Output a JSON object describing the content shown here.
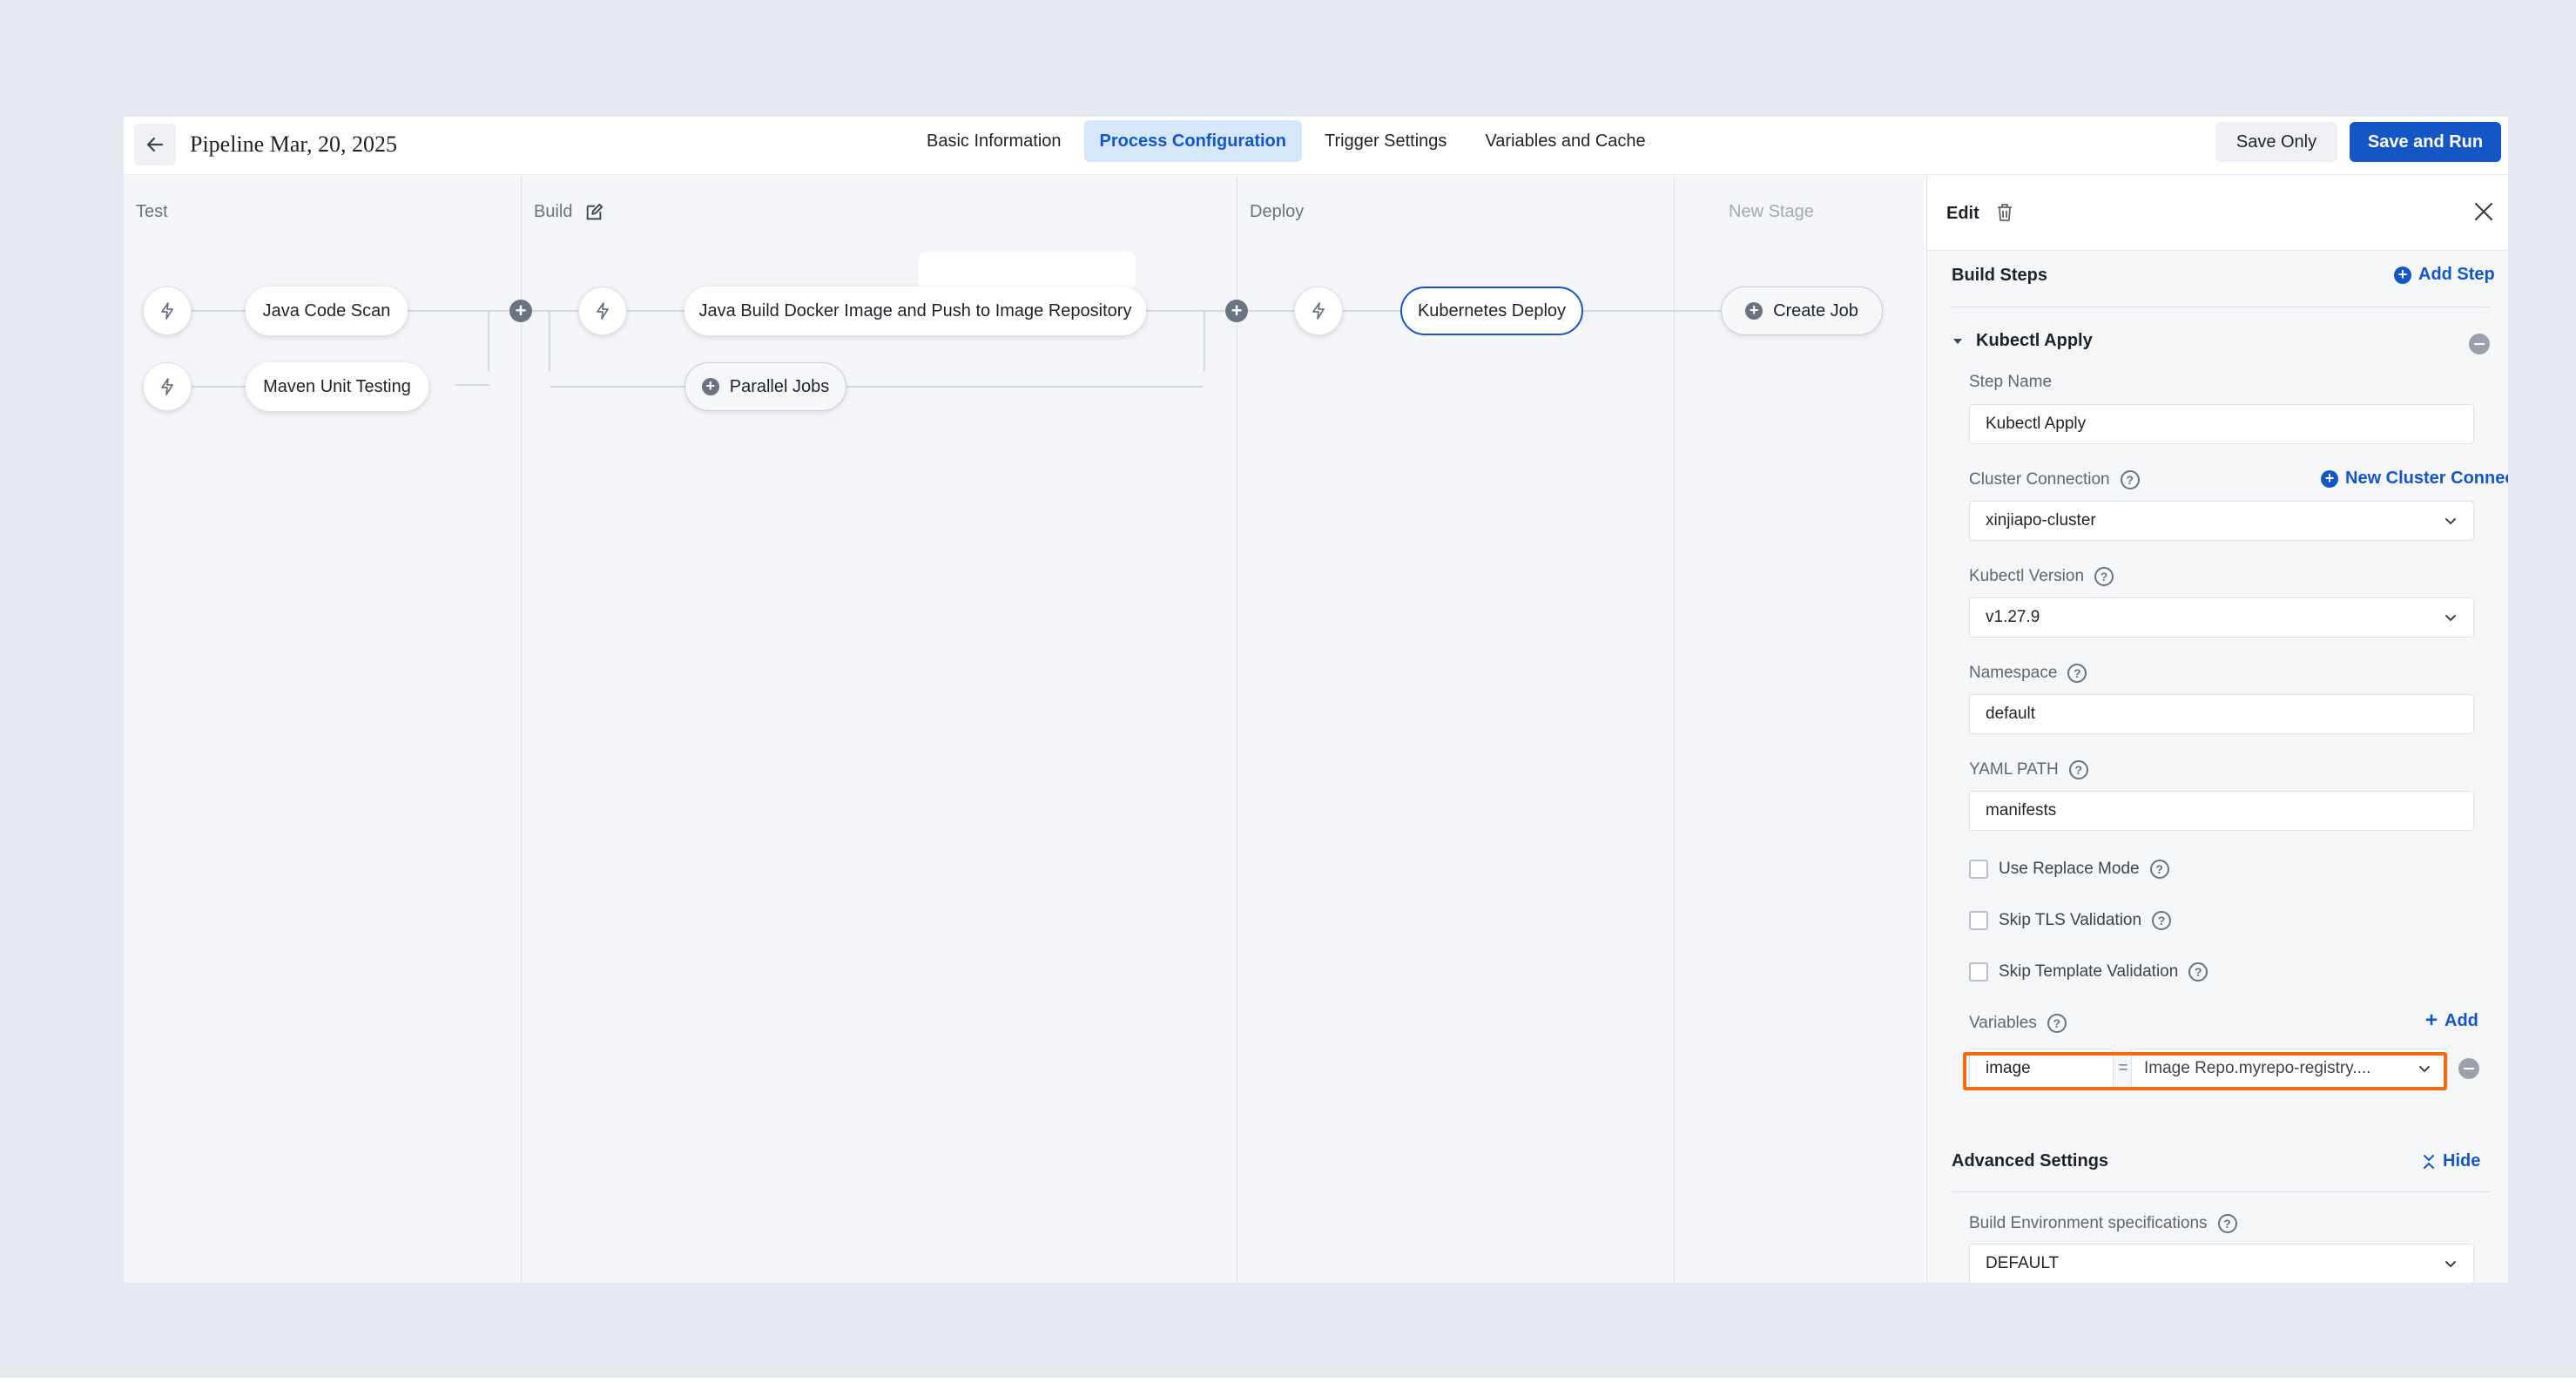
{
  "header": {
    "title": "Pipeline Mar, 20, 2025",
    "tabs": [
      {
        "label": "Basic Information",
        "active": false
      },
      {
        "label": "Process Configuration",
        "active": true
      },
      {
        "label": "Trigger Settings",
        "active": false
      },
      {
        "label": "Variables and Cache",
        "active": false
      }
    ],
    "save_only_label": "Save Only",
    "save_run_label": "Save and Run"
  },
  "stages": [
    {
      "name": "Test",
      "jobs": [
        "Java Code Scan",
        "Maven Unit Testing"
      ]
    },
    {
      "name": "Build",
      "jobs": [
        "Java Build Docker Image and Push to Image Repository"
      ],
      "add_label": "Parallel Jobs"
    },
    {
      "name": "Deploy",
      "jobs": [
        "Kubernetes Deploy"
      ]
    },
    {
      "name": "New Stage",
      "add_label": "Create Job"
    }
  ],
  "panel": {
    "edit_label": "Edit",
    "build_steps_title": "Build Steps",
    "add_step_label": "Add Step",
    "step_title": "Kubectl Apply",
    "step_name_label": "Step Name",
    "step_name_value": "Kubectl Apply",
    "cluster_label": "Cluster Connection",
    "new_cluster_label": "New Cluster Connection",
    "cluster_value": "xinjiapo-cluster",
    "kubectl_version_label": "Kubectl Version",
    "kubectl_version_value": "v1.27.9",
    "namespace_label": "Namespace",
    "namespace_value": "default",
    "yaml_path_label": "YAML PATH",
    "yaml_path_value": "manifests",
    "checkboxes": [
      {
        "label": "Use Replace Mode",
        "checked": false
      },
      {
        "label": "Skip TLS Validation",
        "checked": false
      },
      {
        "label": "Skip Template Validation",
        "checked": false
      }
    ],
    "variables_label": "Variables",
    "add_variable_label": "Add",
    "variable": {
      "key": "image",
      "eq": "=",
      "value": "Image Repo.myrepo-registry...."
    },
    "advanced_title": "Advanced Settings",
    "hide_label": "Hide",
    "build_env_label": "Build Environment specifications",
    "build_env_value": "DEFAULT"
  },
  "colors": {
    "accent": "#1456c4",
    "highlight": "#f26b12",
    "tab_active_bg": "#d6e6fb"
  }
}
